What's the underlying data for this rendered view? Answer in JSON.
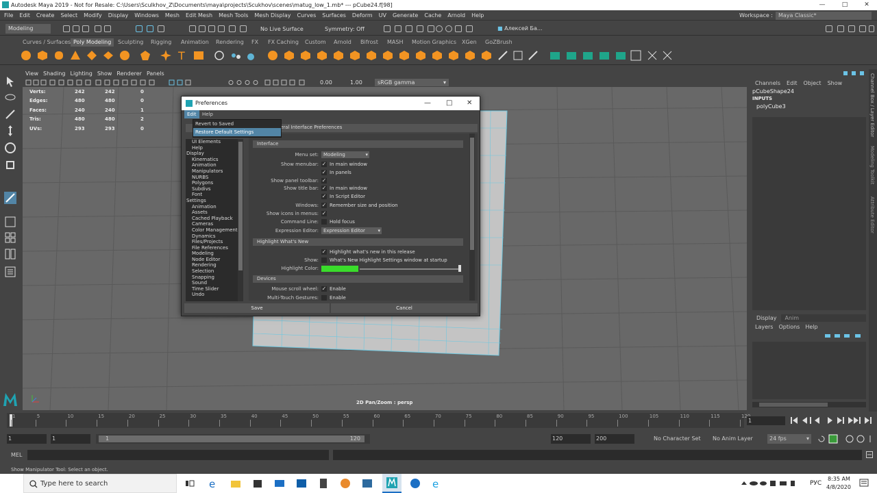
{
  "window": {
    "title": "Autodesk Maya 2019 - Not for Resale: C:\\Users\\Sculkhov_Z\\Documents\\maya\\projects\\Scukhov\\scenes\\matug_low_1.mb*  ---  pCube24.f[98]",
    "minimize": "—",
    "maximize": "□",
    "close": "✕"
  },
  "menubar": {
    "items": [
      "File",
      "Edit",
      "Create",
      "Select",
      "Modify",
      "Display",
      "Windows",
      "Mesh",
      "Edit Mesh",
      "Mesh Tools",
      "Mesh Display",
      "Curves",
      "Surfaces",
      "Deform",
      "UV",
      "Generate",
      "Cache",
      "Arnold",
      "Help"
    ],
    "workspace_label": "Workspace :",
    "workspace_value": "Maya Classic*"
  },
  "statusline": {
    "mode": "Modeling",
    "live_surface": "No Live Surface",
    "symmetry": "Symmetry: Off",
    "user": "Алексей Ба..."
  },
  "shelf": {
    "tabs": [
      "Curves / Surfaces",
      "Poly Modeling",
      "Sculpting",
      "Rigging",
      "Animation",
      "Rendering",
      "FX",
      "FX Caching",
      "Custom",
      "Arnold",
      "Bifrost",
      "MASH",
      "Motion Graphics",
      "XGen",
      "GoZBrush"
    ],
    "active_tab": "Poly Modeling"
  },
  "viewport": {
    "menu": [
      "View",
      "Shading",
      "Lighting",
      "Show",
      "Renderer",
      "Panels"
    ],
    "exposure": "0.00",
    "gamma": "1.00",
    "colorspace": "sRGB gamma",
    "camera_label": "2D Pan/Zoom : persp",
    "hud": [
      {
        "label": "Verts:",
        "a": "242",
        "b": "242",
        "c": "0"
      },
      {
        "label": "Edges:",
        "a": "480",
        "b": "480",
        "c": "0"
      },
      {
        "label": "Faces:",
        "a": "240",
        "b": "240",
        "c": "1"
      },
      {
        "label": "Tris:",
        "a": "480",
        "b": "480",
        "c": "2"
      },
      {
        "label": "UVs:",
        "a": "293",
        "b": "293",
        "c": "0"
      }
    ]
  },
  "channelbox": {
    "menu": [
      "Channels",
      "Edit",
      "Object",
      "Show"
    ],
    "object": "pCubeShape24",
    "inputs": "INPUTS",
    "input_node": "polyCube3",
    "layer_tabs": [
      "Display",
      "Anim"
    ],
    "layer_menu": [
      "Layers",
      "Options",
      "Help"
    ],
    "side_tabs": [
      "Channel Box / Layer Editor",
      "Modeling Toolkit",
      "Attribute Editor"
    ]
  },
  "timeslider": {
    "ticks": [
      "1",
      "5",
      "10",
      "15",
      "20",
      "25",
      "30",
      "35",
      "40",
      "45",
      "50",
      "55",
      "60",
      "65",
      "70",
      "75",
      "80",
      "85",
      "90",
      "95",
      "100",
      "105",
      "110",
      "115",
      "120"
    ],
    "current_frame": "1"
  },
  "range": {
    "start": "1",
    "start2": "1",
    "range_start": "1",
    "range_end": "120",
    "end": "120",
    "end2": "200",
    "character_set": "No Character Set",
    "anim_layer": "No Anim Layer",
    "fps": "24 fps"
  },
  "mel": {
    "label": "MEL"
  },
  "helpline": {
    "text": "Show Manipulator Tool: Select an object."
  },
  "taskbar": {
    "search_placeholder": "Type here to search",
    "time": "8:35 AM",
    "date": "4/8/2020",
    "lang": "РУС"
  },
  "preferences": {
    "title": "Preferences",
    "menu": [
      "Edit",
      "Help"
    ],
    "edit_menu_items": [
      "Revert to Saved",
      "Restore Default Settings"
    ],
    "panel_title": "eral Interface Preferences",
    "categories": [
      "UI Elements",
      "Help",
      "Display",
      "Kinematics",
      "Animation",
      "Manipulators",
      "NURBS",
      "Polygons",
      "Subdivs",
      "Font",
      "Settings",
      "Animation",
      "Assets",
      "Cached Playback",
      "Cameras",
      "Color Management",
      "Dynamics",
      "Files/Projects",
      "File References",
      "Modeling",
      "Node Editor",
      "Rendering",
      "Selection",
      "Snapping",
      "Sound",
      "Time Slider",
      "Undo"
    ],
    "sections": {
      "interface": "Interface",
      "highlight": "Highlight What's New",
      "devices": "Devices"
    },
    "rows": {
      "menu_set_label": "Menu set:",
      "menu_set_value": "Modeling",
      "show_menubar_label": "Show menubar:",
      "in_main_window": "In main window",
      "in_panels": "In panels",
      "show_panel_toolbar_label": "Show panel toolbar:",
      "show_title_bar_label": "Show title bar:",
      "in_main_window_2": "In main window",
      "in_script_editor": "In Script Editor",
      "windows_label": "Windows:",
      "remember_size": "Remember size and position",
      "show_icons_label": "Show icons in menus:",
      "command_line_label": "Command Line:",
      "hold_focus": "Hold focus",
      "expression_editor_label": "Expression Editor:",
      "expression_editor_value": "Expression Editor",
      "highlight_new": "Highlight what's new in this release",
      "show_label": "Show:",
      "whats_new_settings": "What's New Highlight Settings window at startup",
      "highlight_color_label": "Highlight Color:",
      "highlight_color": "#3adc2b",
      "mouse_scroll_label": "Mouse scroll wheel:",
      "enable": "Enable",
      "multitouch_label": "Multi-Touch Gestures:",
      "enable_2": "Enable"
    },
    "save": "Save",
    "cancel": "Cancel"
  }
}
